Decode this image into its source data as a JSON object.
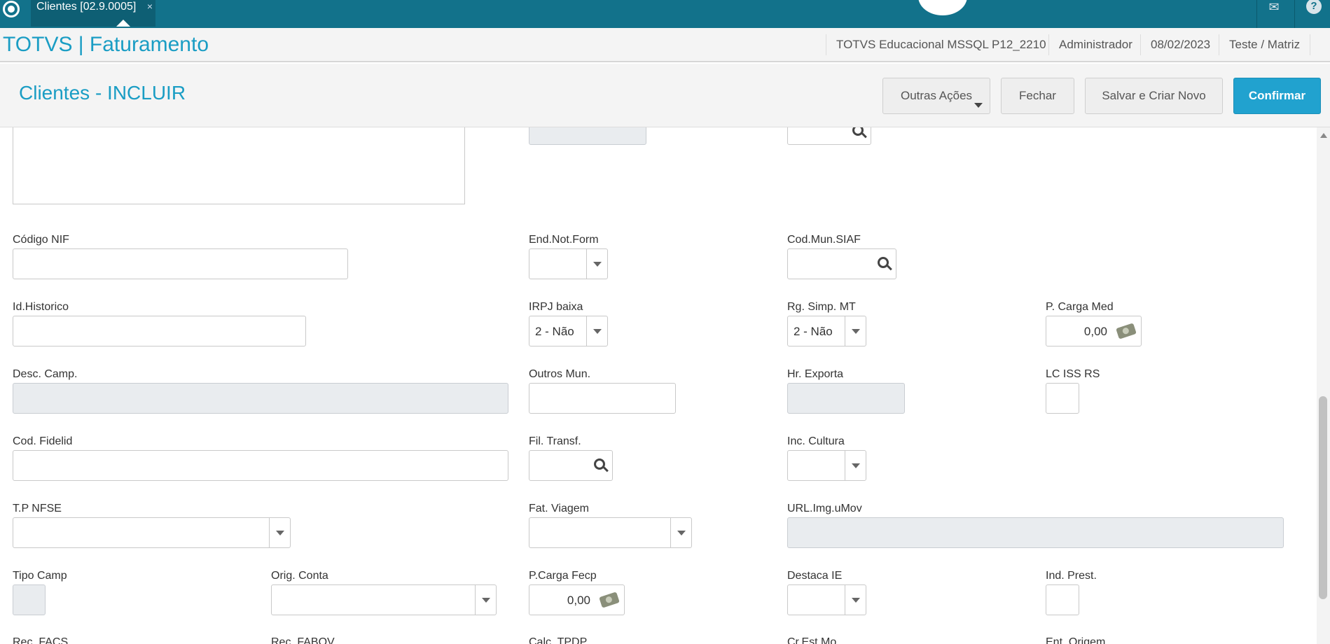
{
  "topbar": {
    "tab_label": "Clientes [02.9.0005]",
    "tab_close": "×",
    "mail_icon": "mail-icon",
    "help_label": "?"
  },
  "appbar": {
    "title": "TOTVS | Faturamento",
    "environment": "TOTVS Educacional MSSQL P12_2210",
    "user": "Administrador",
    "date": "08/02/2023",
    "branch": "Teste / Matriz"
  },
  "pagebar": {
    "title": "Clientes - INCLUIR",
    "buttons": {
      "outras": "Outras Ações",
      "fechar": "Fechar",
      "salvar": "Salvar e Criar Novo",
      "confirmar": "Confirmar"
    }
  },
  "fields": {
    "codigo_nif": {
      "label": "Código NIF",
      "value": ""
    },
    "end_not_form": {
      "label": "End.Not.Form",
      "value": ""
    },
    "cod_mun_siaf": {
      "label": "Cod.Mun.SIAF",
      "value": ""
    },
    "id_historico": {
      "label": "Id.Historico",
      "value": ""
    },
    "irpj_baixa": {
      "label": "IRPJ baixa",
      "value": "2 - Não"
    },
    "rg_simp_mt": {
      "label": "Rg. Simp. MT",
      "value": "2 - Não"
    },
    "p_carga_med": {
      "label": "P. Carga Med",
      "value": "0,00"
    },
    "desc_camp": {
      "label": "Desc. Camp.",
      "value": ""
    },
    "outros_mun": {
      "label": "Outros Mun.",
      "value": ""
    },
    "hr_exporta": {
      "label": "Hr. Exporta",
      "value": ""
    },
    "lc_iss_rs": {
      "label": "LC ISS RS",
      "value": ""
    },
    "cod_fidelid": {
      "label": "Cod. Fidelid",
      "value": ""
    },
    "fil_transf": {
      "label": "Fil. Transf.",
      "value": ""
    },
    "inc_cultura": {
      "label": "Inc. Cultura",
      "value": ""
    },
    "tp_nfse": {
      "label": "T.P NFSE",
      "value": ""
    },
    "fat_viagem": {
      "label": "Fat. Viagem",
      "value": ""
    },
    "url_img_umov": {
      "label": "URL.Img.uMov",
      "value": ""
    },
    "tipo_camp": {
      "label": "Tipo Camp",
      "value": ""
    },
    "orig_conta": {
      "label": "Orig. Conta",
      "value": ""
    },
    "p_carga_fecp": {
      "label": "P.Carga Fecp",
      "value": "0,00"
    },
    "destaca_ie": {
      "label": "Destaca IE",
      "value": ""
    },
    "ind_prest": {
      "label": "Ind. Prest.",
      "value": ""
    },
    "cut_labels": [
      "Rec. FACS",
      "Rec. FABOV",
      "Calc. TPDP",
      "Cr.Est.Mo",
      "Ent. Origem"
    ]
  },
  "icons": {
    "search": "search-icon",
    "dropdown": "chevron-down-icon",
    "calculator": "calculator-icon"
  }
}
